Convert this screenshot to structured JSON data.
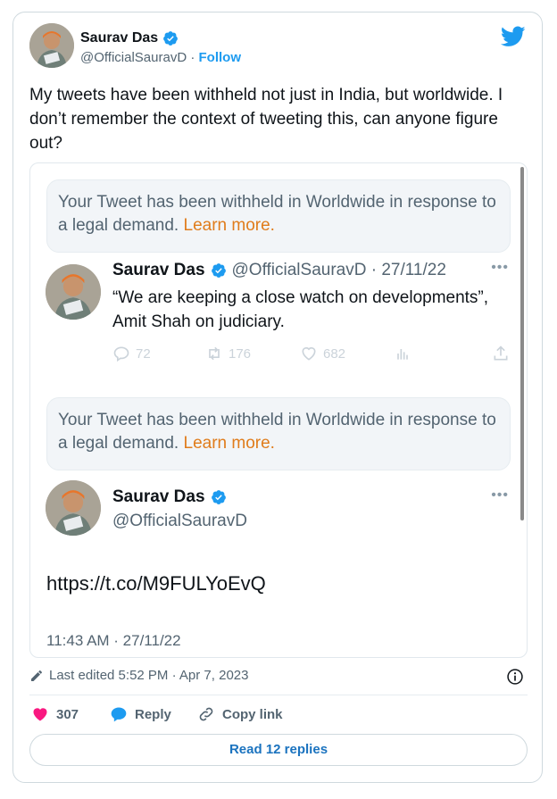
{
  "author": {
    "name": "Saurav Das",
    "handle": "@OfficialSauravD",
    "separator": "·",
    "follow_label": "Follow"
  },
  "tweet": {
    "text": "My tweets have been withheld not just in India, but worldwide. I don’t remember the context of tweeting this, can anyone figure out?"
  },
  "screenshot": {
    "withheld_notice": {
      "text": "Your Tweet has been withheld in Worldwide in response to a legal demand.",
      "learn_more": "Learn more."
    },
    "quoted_tweet": {
      "name": "Saurav Das",
      "handle_date": "@OfficialSauravD · 27/11/22",
      "body": "“We are keeping a close watch on developments”, Amit Shah on judiciary.",
      "replies": "72",
      "retweets": "176",
      "likes": "682"
    },
    "second_withheld_notice": {
      "text": "Your Tweet has been withheld in Worldwide in response to a legal demand.",
      "learn_more": "Learn more."
    },
    "second_tweet": {
      "name": "Saurav Das",
      "handle": "@OfficialSauravD",
      "link": "https://t.co/M9FULYoEvQ",
      "timestamp": "11:43 AM · 27/11/22"
    }
  },
  "footer": {
    "edited": "Last edited 5:52 PM · Apr 7, 2023",
    "likes_count": "307",
    "reply_label": "Reply",
    "copy_link_label": "Copy link",
    "read_replies_label": "Read 12 replies"
  },
  "colors": {
    "accent": "#1d9bf0",
    "learn_more": "#e07c1b",
    "like": "#f91880"
  }
}
